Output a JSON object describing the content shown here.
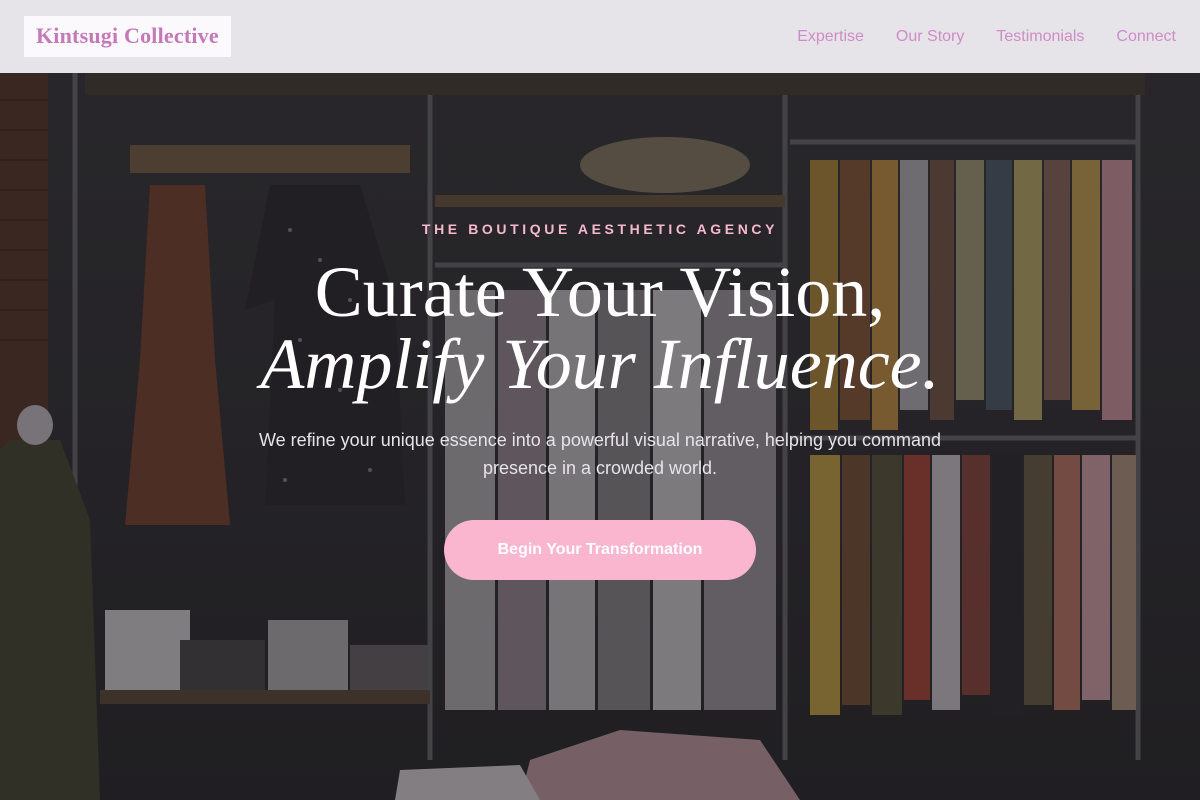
{
  "brand": {
    "name": "Kintsugi Collective"
  },
  "nav": {
    "links": [
      "Expertise",
      "Our Story",
      "Testimonials",
      "Connect"
    ]
  },
  "hero": {
    "eyebrow": "THE BOUTIQUE AESTHETIC AGENCY",
    "headline_line1": "Curate Your Vision,",
    "headline_line2": "Amplify Your Influence.",
    "subtext": "We refine your unique essence into a powerful visual narrative, helping you command presence in a crowded world.",
    "cta_label": "Begin Your Transformation"
  },
  "colors": {
    "brand_pink": "#c47ab9",
    "nav_link": "#cf8cc7",
    "eyebrow": "#f6b9cc",
    "cta_bg": "#fbb6cf"
  }
}
